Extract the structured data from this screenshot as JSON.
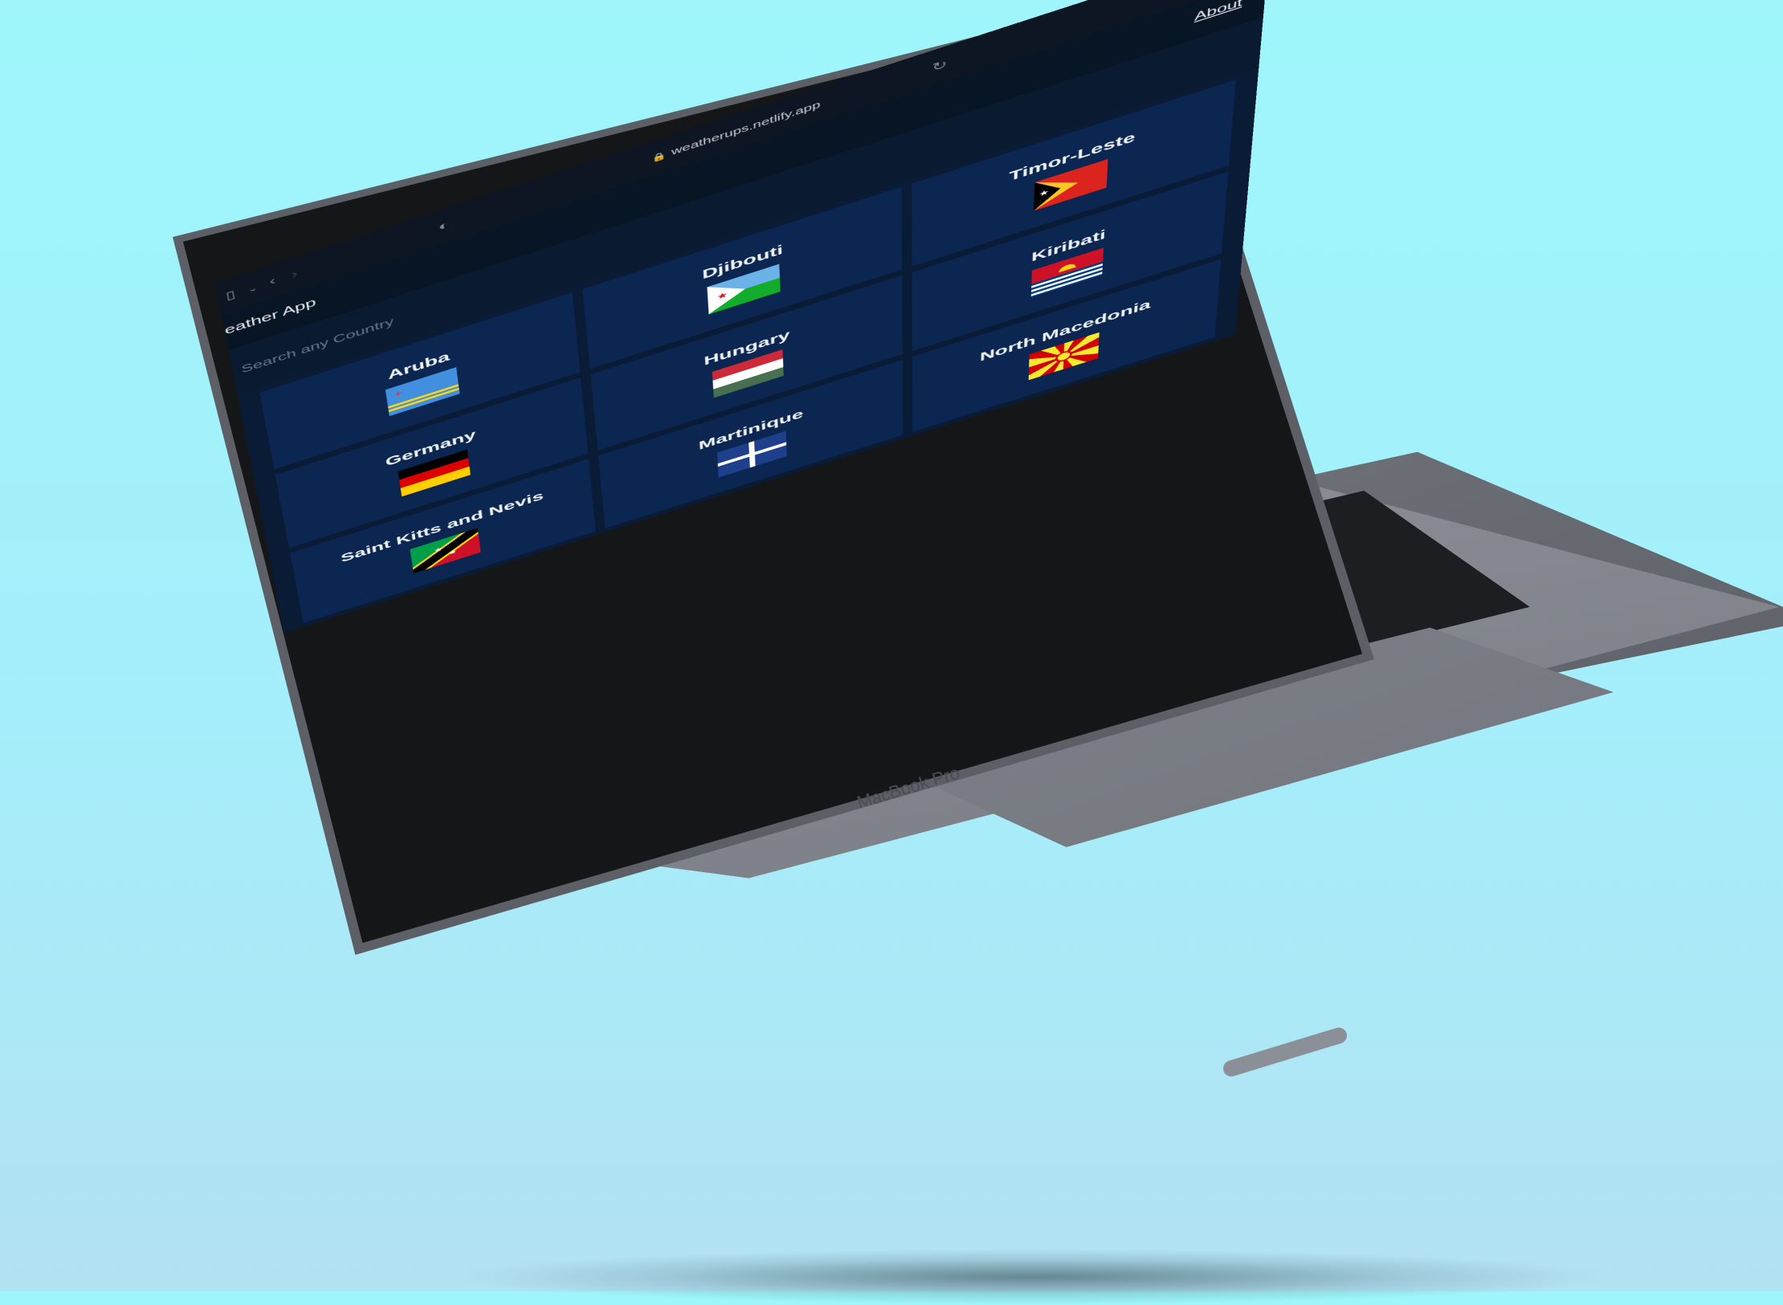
{
  "browser": {
    "url": "weatherups.netlify.app"
  },
  "app": {
    "title": "eather App",
    "about_link": "About",
    "search_placeholder": "Search any Country"
  },
  "laptop": {
    "brand_label": "MacBook Pro"
  },
  "countries": [
    {
      "name": "Aruba",
      "flag_icon": "aruba-flag-icon"
    },
    {
      "name": "Djibouti",
      "flag_icon": "djibouti-flag-icon"
    },
    {
      "name": "Timor-Leste",
      "flag_icon": "timor-leste-flag-icon"
    },
    {
      "name": "Germany",
      "flag_icon": "germany-flag-icon"
    },
    {
      "name": "Hungary",
      "flag_icon": "hungary-flag-icon"
    },
    {
      "name": "Kiribati",
      "flag_icon": "kiribati-flag-icon"
    },
    {
      "name": "Saint Kitts and Nevis",
      "flag_icon": "saint-kitts-and-nevis-flag-icon"
    },
    {
      "name": "Martinique",
      "flag_icon": "martinique-flag-icon"
    },
    {
      "name": "North Macedonia",
      "flag_icon": "north-macedonia-flag-icon"
    }
  ],
  "colors": {
    "background": "#9ef6fb",
    "page": "#0a1b36",
    "card": "#0b2650"
  }
}
